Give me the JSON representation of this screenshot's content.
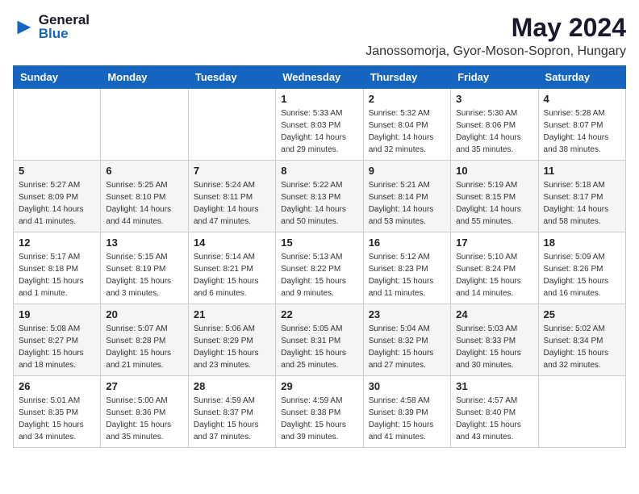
{
  "header": {
    "logo_general": "General",
    "logo_blue": "Blue",
    "title": "May 2024",
    "subtitle": "Janossomorja, Gyor-Moson-Sopron, Hungary"
  },
  "weekdays": [
    "Sunday",
    "Monday",
    "Tuesday",
    "Wednesday",
    "Thursday",
    "Friday",
    "Saturday"
  ],
  "weeks": [
    [
      {
        "day": "",
        "info": ""
      },
      {
        "day": "",
        "info": ""
      },
      {
        "day": "",
        "info": ""
      },
      {
        "day": "1",
        "info": "Sunrise: 5:33 AM\nSunset: 8:03 PM\nDaylight: 14 hours\nand 29 minutes."
      },
      {
        "day": "2",
        "info": "Sunrise: 5:32 AM\nSunset: 8:04 PM\nDaylight: 14 hours\nand 32 minutes."
      },
      {
        "day": "3",
        "info": "Sunrise: 5:30 AM\nSunset: 8:06 PM\nDaylight: 14 hours\nand 35 minutes."
      },
      {
        "day": "4",
        "info": "Sunrise: 5:28 AM\nSunset: 8:07 PM\nDaylight: 14 hours\nand 38 minutes."
      }
    ],
    [
      {
        "day": "5",
        "info": "Sunrise: 5:27 AM\nSunset: 8:09 PM\nDaylight: 14 hours\nand 41 minutes."
      },
      {
        "day": "6",
        "info": "Sunrise: 5:25 AM\nSunset: 8:10 PM\nDaylight: 14 hours\nand 44 minutes."
      },
      {
        "day": "7",
        "info": "Sunrise: 5:24 AM\nSunset: 8:11 PM\nDaylight: 14 hours\nand 47 minutes."
      },
      {
        "day": "8",
        "info": "Sunrise: 5:22 AM\nSunset: 8:13 PM\nDaylight: 14 hours\nand 50 minutes."
      },
      {
        "day": "9",
        "info": "Sunrise: 5:21 AM\nSunset: 8:14 PM\nDaylight: 14 hours\nand 53 minutes."
      },
      {
        "day": "10",
        "info": "Sunrise: 5:19 AM\nSunset: 8:15 PM\nDaylight: 14 hours\nand 55 minutes."
      },
      {
        "day": "11",
        "info": "Sunrise: 5:18 AM\nSunset: 8:17 PM\nDaylight: 14 hours\nand 58 minutes."
      }
    ],
    [
      {
        "day": "12",
        "info": "Sunrise: 5:17 AM\nSunset: 8:18 PM\nDaylight: 15 hours\nand 1 minute."
      },
      {
        "day": "13",
        "info": "Sunrise: 5:15 AM\nSunset: 8:19 PM\nDaylight: 15 hours\nand 3 minutes."
      },
      {
        "day": "14",
        "info": "Sunrise: 5:14 AM\nSunset: 8:21 PM\nDaylight: 15 hours\nand 6 minutes."
      },
      {
        "day": "15",
        "info": "Sunrise: 5:13 AM\nSunset: 8:22 PM\nDaylight: 15 hours\nand 9 minutes."
      },
      {
        "day": "16",
        "info": "Sunrise: 5:12 AM\nSunset: 8:23 PM\nDaylight: 15 hours\nand 11 minutes."
      },
      {
        "day": "17",
        "info": "Sunrise: 5:10 AM\nSunset: 8:24 PM\nDaylight: 15 hours\nand 14 minutes."
      },
      {
        "day": "18",
        "info": "Sunrise: 5:09 AM\nSunset: 8:26 PM\nDaylight: 15 hours\nand 16 minutes."
      }
    ],
    [
      {
        "day": "19",
        "info": "Sunrise: 5:08 AM\nSunset: 8:27 PM\nDaylight: 15 hours\nand 18 minutes."
      },
      {
        "day": "20",
        "info": "Sunrise: 5:07 AM\nSunset: 8:28 PM\nDaylight: 15 hours\nand 21 minutes."
      },
      {
        "day": "21",
        "info": "Sunrise: 5:06 AM\nSunset: 8:29 PM\nDaylight: 15 hours\nand 23 minutes."
      },
      {
        "day": "22",
        "info": "Sunrise: 5:05 AM\nSunset: 8:31 PM\nDaylight: 15 hours\nand 25 minutes."
      },
      {
        "day": "23",
        "info": "Sunrise: 5:04 AM\nSunset: 8:32 PM\nDaylight: 15 hours\nand 27 minutes."
      },
      {
        "day": "24",
        "info": "Sunrise: 5:03 AM\nSunset: 8:33 PM\nDaylight: 15 hours\nand 30 minutes."
      },
      {
        "day": "25",
        "info": "Sunrise: 5:02 AM\nSunset: 8:34 PM\nDaylight: 15 hours\nand 32 minutes."
      }
    ],
    [
      {
        "day": "26",
        "info": "Sunrise: 5:01 AM\nSunset: 8:35 PM\nDaylight: 15 hours\nand 34 minutes."
      },
      {
        "day": "27",
        "info": "Sunrise: 5:00 AM\nSunset: 8:36 PM\nDaylight: 15 hours\nand 35 minutes."
      },
      {
        "day": "28",
        "info": "Sunrise: 4:59 AM\nSunset: 8:37 PM\nDaylight: 15 hours\nand 37 minutes."
      },
      {
        "day": "29",
        "info": "Sunrise: 4:59 AM\nSunset: 8:38 PM\nDaylight: 15 hours\nand 39 minutes."
      },
      {
        "day": "30",
        "info": "Sunrise: 4:58 AM\nSunset: 8:39 PM\nDaylight: 15 hours\nand 41 minutes."
      },
      {
        "day": "31",
        "info": "Sunrise: 4:57 AM\nSunset: 8:40 PM\nDaylight: 15 hours\nand 43 minutes."
      },
      {
        "day": "",
        "info": ""
      }
    ]
  ]
}
